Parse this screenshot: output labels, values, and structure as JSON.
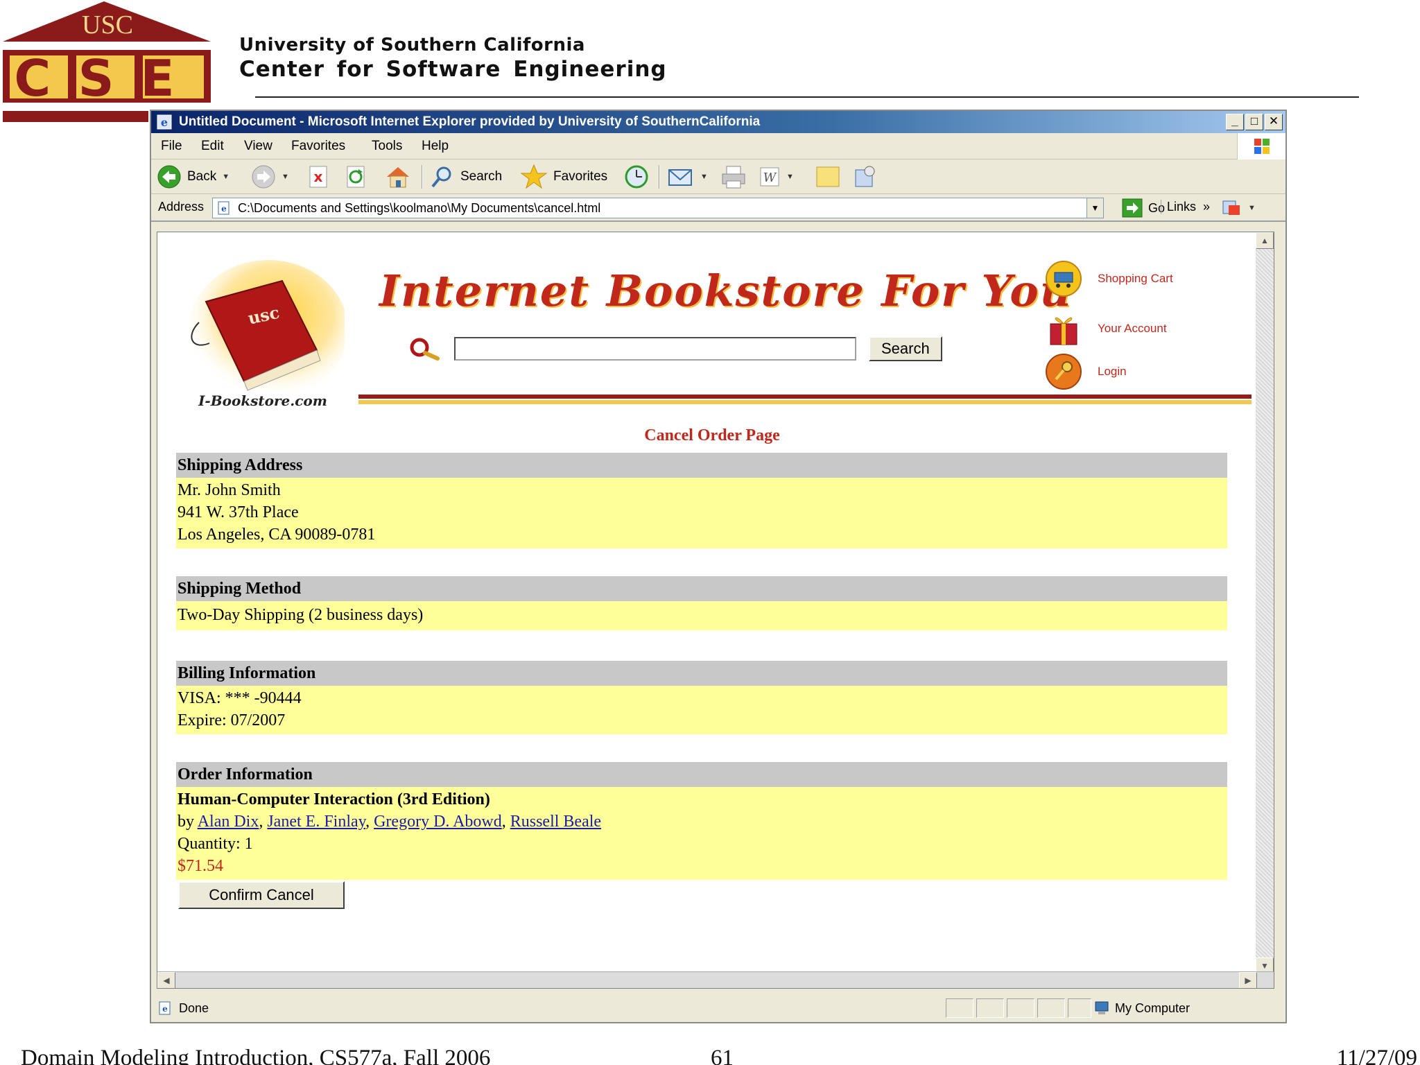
{
  "slide": {
    "logo_top": "USC",
    "logo_letters": "CSE",
    "title_line1": "University of Southern California",
    "title_line2": "Center for Software  Engineering",
    "footer_left": "Domain Modeling Introduction, CS577a, Fall 2006",
    "footer_page": "61",
    "footer_date": "11/27/09"
  },
  "browser": {
    "title": "Untitled Document - Microsoft Internet Explorer provided by University of SouthernCalifornia",
    "menu": [
      "File",
      "Edit",
      "View",
      "Favorites",
      "Tools",
      "Help"
    ],
    "toolbar": {
      "back_label": "Back",
      "search_label": "Search",
      "favorites_label": "Favorites"
    },
    "address_label": "Address",
    "address_value": "C:\\Documents and Settings\\koolmano\\My Documents\\cancel.html",
    "go_label": "Go",
    "links_label": "Links",
    "status_text": "Done",
    "zone_label": "My Computer"
  },
  "store": {
    "logo_book_text": "usc",
    "logo_caption": "I-Bookstore.com",
    "title": "Internet Bookstore For You",
    "search_button": "Search",
    "links": {
      "cart": "Shopping Cart",
      "account": "Your Account",
      "login": "Login"
    }
  },
  "page": {
    "heading": "Cancel Order Page",
    "shipping_address": {
      "title": "Shipping Address",
      "name": "Mr. John Smith",
      "street": "941 W. 37th Place",
      "city": "Los Angeles, CA 90089-0781"
    },
    "shipping_method": {
      "title": "Shipping Method",
      "value": "Two-Day Shipping (2 business days)"
    },
    "billing": {
      "title": "Billing Information",
      "card": "VISA: *** -90444",
      "expire": "Expire: 07/2007"
    },
    "order": {
      "title": "Order Information",
      "book_title": "Human-Computer Interaction (3rd Edition)",
      "by": "by",
      "authors": [
        "Alan Dix",
        "Janet E. Finlay",
        "Gregory D. Abowd",
        "Russell Beale"
      ],
      "quantity": "Quantity: 1",
      "price": "$71.54"
    },
    "confirm_button": "Confirm Cancel"
  },
  "colors": {
    "accent_red": "#c0281c",
    "section_bg": "#ffff99",
    "section_head": "#c8c8c8",
    "link_blue": "#1a1aa6"
  }
}
